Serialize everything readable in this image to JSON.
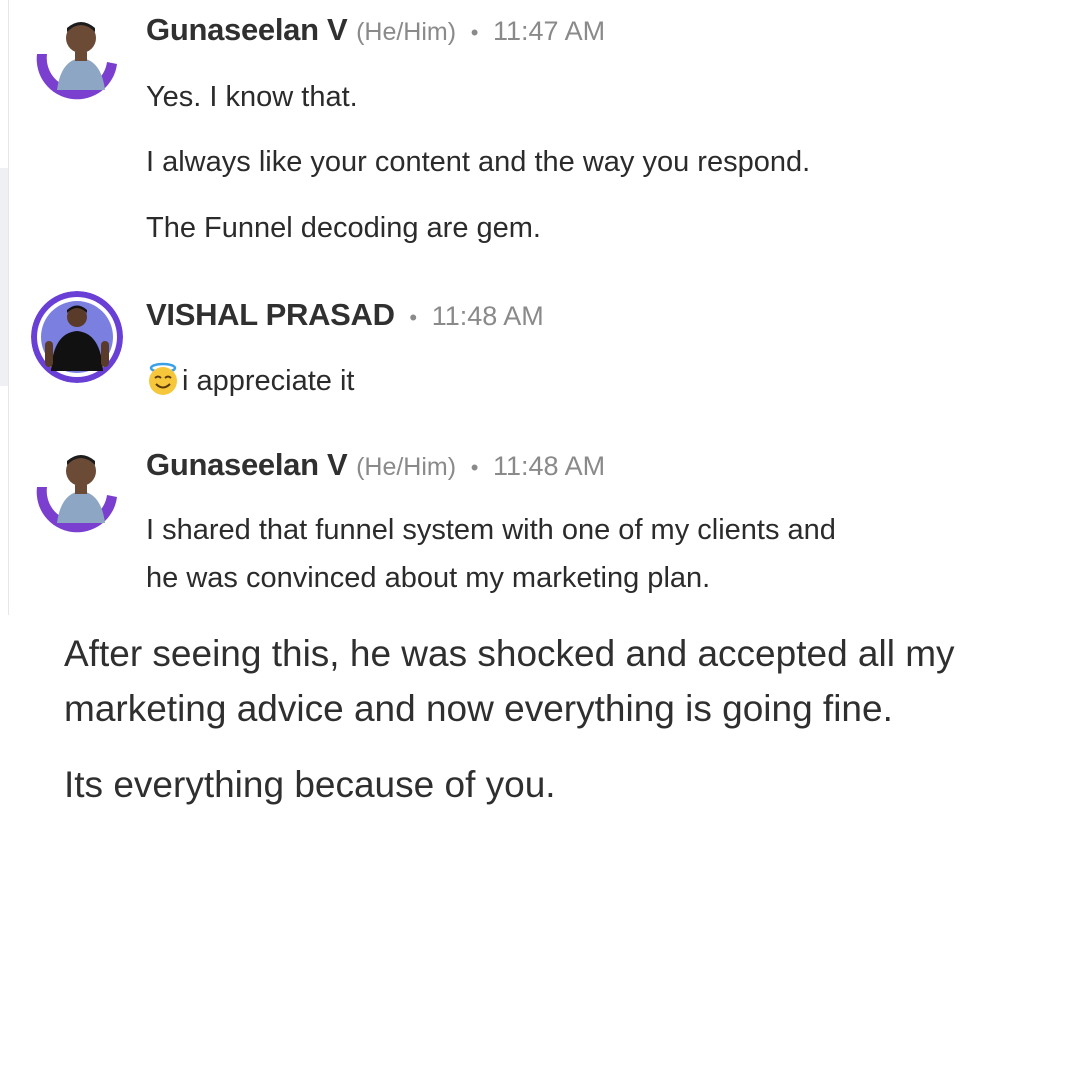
{
  "messages": [
    {
      "sender": "Gunaseelan V",
      "pronoun": "(He/Him)",
      "separator": "•",
      "time": "11:47 AM",
      "lines": [
        "Yes. I know that.",
        "I always like your content and the way you respond.",
        "The Funnel decoding are gem."
      ]
    },
    {
      "sender": "VISHAL PRASAD",
      "separator": "•",
      "time": "11:48 AM",
      "emoji_icon": "smiling-face-with-halo-icon",
      "lines": [
        "i appreciate it"
      ]
    },
    {
      "sender": "Gunaseelan V",
      "pronoun": "(He/Him)",
      "separator": "•",
      "time": "11:48 AM",
      "lines": [
        "I shared that funnel system with one of my clients and",
        "he was convinced about my marketing plan."
      ]
    }
  ],
  "continuation": {
    "lines": [
      "After seeing this, he was shocked and accepted all my",
      "marketing advice and now everything is going fine.",
      "Its everything because of you."
    ]
  },
  "colors": {
    "avatar_ring_gunaseelan": "#7b3fd0",
    "avatar_ring_vishal": "#6a3fd6",
    "timestamp_gray": "#8a8a8a",
    "text": "#2b2b2b"
  }
}
